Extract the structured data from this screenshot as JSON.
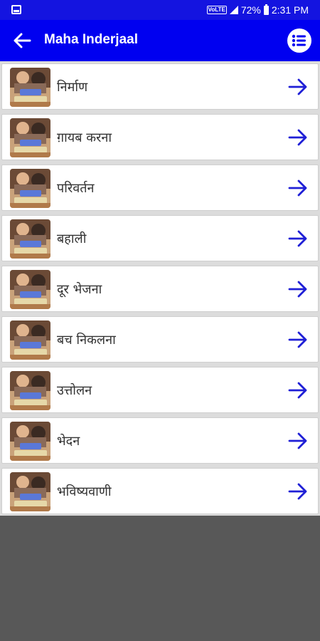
{
  "status_bar": {
    "network_badge": "VoLTE",
    "battery_percent": "72%",
    "time": "2:31 PM"
  },
  "toolbar": {
    "title": "Maha Inderjaal"
  },
  "colors": {
    "primary": "#0000f0",
    "status_bar": "#1414e0",
    "arrow": "#1f1fd6",
    "background": "#585858"
  },
  "list": {
    "items": [
      {
        "label": "निर्माण"
      },
      {
        "label": "ग़ायब करना"
      },
      {
        "label": "परिवर्तन"
      },
      {
        "label": "बहाली"
      },
      {
        "label": "दूर भेजना"
      },
      {
        "label": "बच निकलना"
      },
      {
        "label": "उत्तोलन"
      },
      {
        "label": "भेदन"
      },
      {
        "label": "भविष्यवाणी"
      }
    ]
  }
}
